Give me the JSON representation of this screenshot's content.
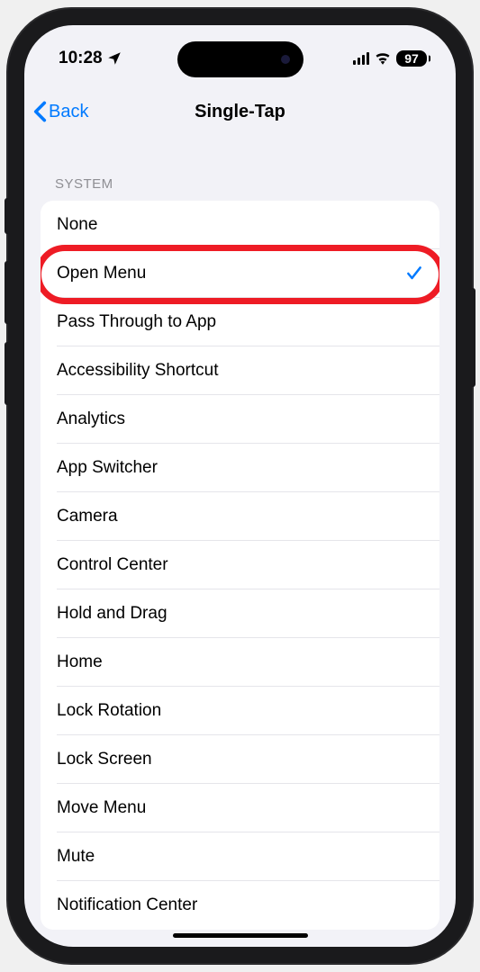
{
  "statusBar": {
    "time": "10:28",
    "battery": "97"
  },
  "nav": {
    "back": "Back",
    "title": "Single-Tap"
  },
  "section": {
    "header": "SYSTEM",
    "items": [
      {
        "label": "None",
        "selected": false
      },
      {
        "label": "Open Menu",
        "selected": true
      },
      {
        "label": "Pass Through to App",
        "selected": false
      },
      {
        "label": "Accessibility Shortcut",
        "selected": false
      },
      {
        "label": "Analytics",
        "selected": false
      },
      {
        "label": "App Switcher",
        "selected": false
      },
      {
        "label": "Camera",
        "selected": false
      },
      {
        "label": "Control Center",
        "selected": false
      },
      {
        "label": "Hold and Drag",
        "selected": false
      },
      {
        "label": "Home",
        "selected": false
      },
      {
        "label": "Lock Rotation",
        "selected": false
      },
      {
        "label": "Lock Screen",
        "selected": false
      },
      {
        "label": "Move Menu",
        "selected": false
      },
      {
        "label": "Mute",
        "selected": false
      },
      {
        "label": "Notification Center",
        "selected": false
      }
    ]
  }
}
